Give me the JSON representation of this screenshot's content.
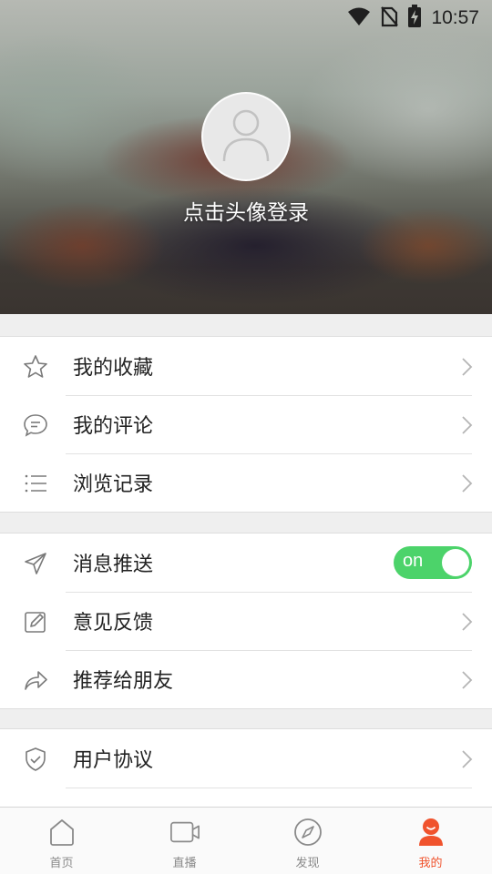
{
  "status_bar": {
    "time": "10:57",
    "icons": [
      "wifi-icon",
      "no-sim-icon",
      "battery-charging-icon"
    ]
  },
  "profile": {
    "login_prompt": "点击头像登录",
    "avatar_icon": "person-icon"
  },
  "groups": [
    {
      "items": [
        {
          "label": "我的收藏",
          "icon": "star-icon"
        },
        {
          "label": "我的评论",
          "icon": "comment-icon"
        },
        {
          "label": "浏览记录",
          "icon": "list-icon"
        }
      ]
    },
    {
      "items": [
        {
          "label": "消息推送",
          "icon": "send-icon",
          "toggle": {
            "label": "on",
            "state": true
          }
        },
        {
          "label": "意见反馈",
          "icon": "edit-icon"
        },
        {
          "label": "推荐给朋友",
          "icon": "share-icon"
        }
      ]
    },
    {
      "items": [
        {
          "label": "用户协议",
          "icon": "shield-icon"
        }
      ]
    }
  ],
  "bottom_nav": [
    {
      "label": "首页",
      "icon": "home-icon",
      "active": false
    },
    {
      "label": "直播",
      "icon": "video-icon",
      "active": false
    },
    {
      "label": "发现",
      "icon": "compass-icon",
      "active": false
    },
    {
      "label": "我的",
      "icon": "profile-icon",
      "active": true
    }
  ],
  "colors": {
    "accent": "#f0532d",
    "toggle_on": "#4cd36a",
    "background": "#efefef"
  }
}
